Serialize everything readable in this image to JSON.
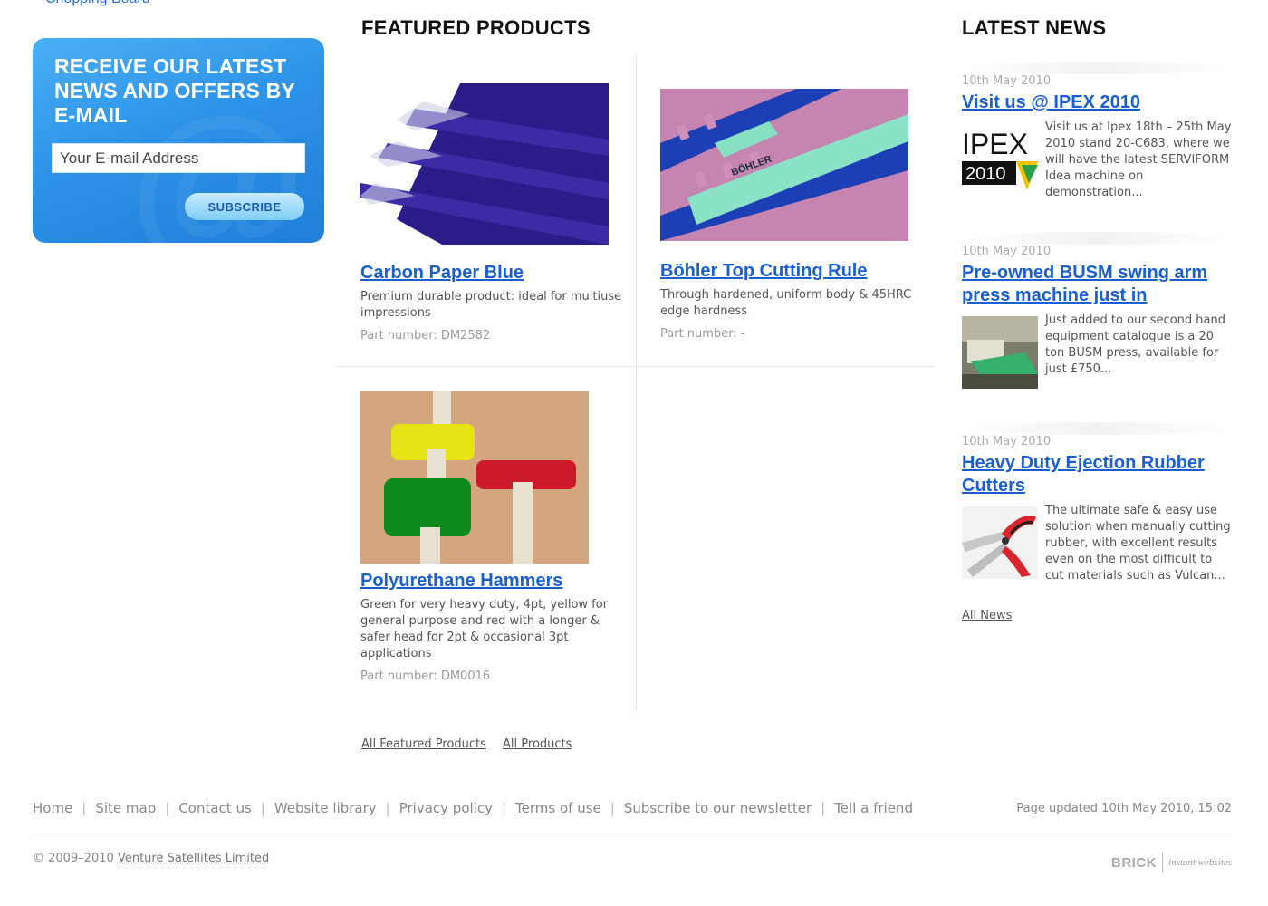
{
  "top_link": "Chopping Board",
  "newsletter": {
    "heading": "Receive our latest news and offers by e-mail",
    "email_placeholder": "Your E-mail Address",
    "subscribe_label": "SUBSCRIBE"
  },
  "featured": {
    "heading": "FEATURED PRODUCTS",
    "products": [
      {
        "title": "Carbon Paper Blue",
        "description": "Premium durable product: ideal for multiuse impressions",
        "part_number": "Part number: DM2582",
        "image": "carbon-paper-blue-photo"
      },
      {
        "title": "Böhler Top Cutting Rule",
        "description": "Through hardened, uniform body & 45HRC edge hardness",
        "part_number": "Part number: -",
        "image": "bohler-cutting-rule-photo",
        "image_text": "BÖHLER"
      },
      {
        "title": "Polyurethane Hammers",
        "description": "Green for very heavy duty, 4pt, yellow for general purpose and red with a longer & safer head for 2pt & occasional 3pt applications",
        "part_number": "Part number: DM0016",
        "image": "polyurethane-hammers-photo"
      }
    ],
    "links": {
      "all_featured": "All Featured Products",
      "all_products": "All Products"
    }
  },
  "news": {
    "heading": "LATEST NEWS",
    "items": [
      {
        "date": "10th May 2010",
        "title": "Visit us @ IPEX 2010",
        "summary": "Visit us at Ipex 18th – 25th May 2010 stand 20-C683, where we will have the latest SERVIFORM Idea machine on demonstration...",
        "thumb": "ipex-logo",
        "thumb_text_1": "IPEX",
        "thumb_text_2": "2010"
      },
      {
        "date": "10th May 2010",
        "title": "Pre-owned BUSM swing arm press machine just in",
        "summary": "Just added to our second hand equipment catalogue is a 20 ton BUSM press, available for just £750...",
        "thumb": "press-machine-photo"
      },
      {
        "date": "10th May 2010",
        "title": "Heavy Duty Ejection Rubber Cutters",
        "summary": "The ultimate safe & easy use solution when manually cutting rubber, with excellent results even on the most difficult to cut materials such as Vulcan...",
        "thumb": "rubber-cutters-photo"
      }
    ],
    "all_news": "All News"
  },
  "footer": {
    "nav": [
      "Home",
      "Site map",
      "Contact us",
      "Website library",
      "Privacy policy",
      "Terms of use",
      "Subscribe to our newsletter",
      "Tell a friend"
    ],
    "page_updated": "Page updated 10th May 2010, 15:02",
    "copyright_prefix": "© 2009–2010",
    "company": "Venture Satellites Limited",
    "brand_logo": "BRICK",
    "brand_tagline": "instant websites"
  },
  "colors": {
    "link": "#1a5fd0",
    "newsletter_bg": "#2d93e8",
    "heading": "#111111"
  }
}
